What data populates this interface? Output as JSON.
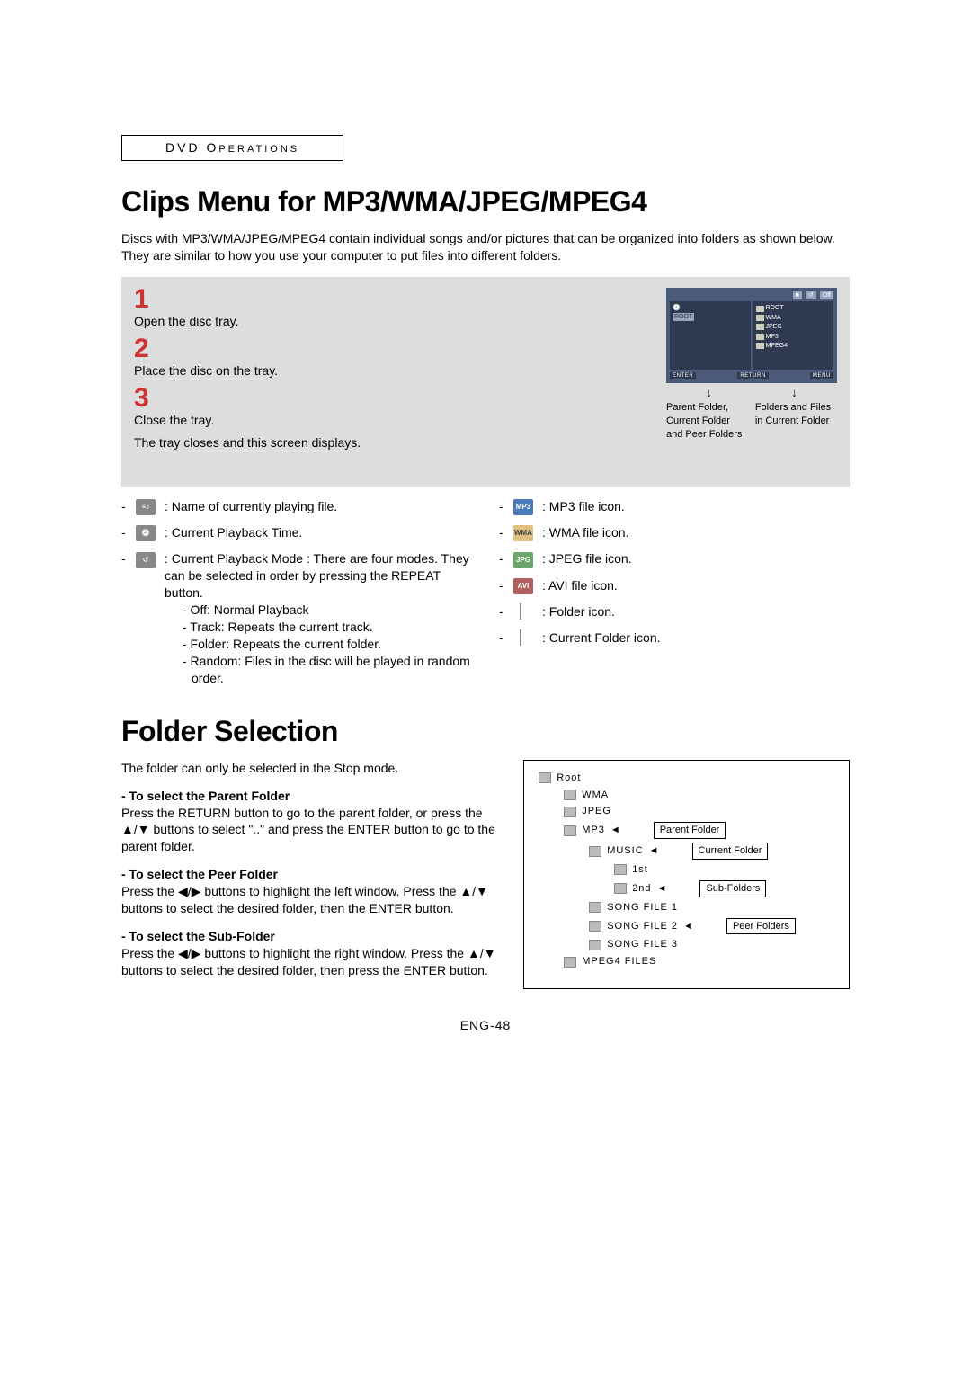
{
  "section": {
    "label_pre": "DVD O",
    "label_suf": "PERATIONS"
  },
  "h1_clips": "Clips Menu for MP3/WMA/JPEG/MPEG4",
  "intro": "Discs with MP3/WMA/JPEG/MPEG4 contain individual songs and/or pictures that can be organized into folders as shown below. They are similar to how you use your computer to put files into different folders.",
  "steps": {
    "n1": "1",
    "t1": "Open the disc tray.",
    "n2": "2",
    "t2": "Place the disc on the tray.",
    "n3": "3",
    "t3a": "Close the tray.",
    "t3b": "The tray closes and this screen displays."
  },
  "mock": {
    "off": "Off",
    "root_l": "ROOT",
    "root_r": "ROOT",
    "items": [
      "WMA",
      "JPEG",
      "MP3",
      "MPEG4"
    ],
    "bot1": "ENTER",
    "bot2": "RETURN",
    "bot3": "MENU",
    "cap_l": "Parent Folder, Current Folder and Peer Folders",
    "cap_r": "Folders and Files in Current Folder"
  },
  "iconsL": {
    "l1": "Name of currently playing file.",
    "l2": "Current Playback Time.",
    "l3": "Current Playback Mode : There are four modes. They can be selected in order by pressing the REPEAT button.",
    "b1": "- Off: Normal Playback",
    "b2": "- Track: Repeats the current track.",
    "b3": "- Folder: Repeats the current folder.",
    "b4": "- Random: Files in the disc will be played in random order."
  },
  "iconsR": {
    "mp3": ": MP3 file icon.",
    "wma": ": WMA file icon.",
    "jpg": ": JPEG file icon.",
    "avi": ": AVI file icon.",
    "fld": ": Folder icon.",
    "cur": ": Current Folder icon."
  },
  "h1_folder": "Folder Selection",
  "folder": {
    "lead": "The folder can only be selected in the Stop mode.",
    "p1h": "- To select the Parent Folder",
    "p1": "Press the RETURN button to go to the parent folder, or press the ▲/▼ buttons to select \"..\" and press the ENTER button to go to the parent folder.",
    "p2h": "- To select the Peer Folder",
    "p2": "Press the ◀/▶ buttons to highlight the left window. Press the ▲/▼ buttons to select the desired folder, then the ENTER button.",
    "p3h": "- To select the Sub-Folder",
    "p3": "Press the ◀/▶ buttons to highlight the right window. Press the ▲/▼ buttons to select the desired folder, then press the ENTER button."
  },
  "chart_data": {
    "type": "tree",
    "nodes": [
      {
        "level": 0,
        "label": "Root"
      },
      {
        "level": 1,
        "label": "WMA"
      },
      {
        "level": 1,
        "label": "JPEG"
      },
      {
        "level": 1,
        "label": "MP3",
        "callout": "Parent Folder"
      },
      {
        "level": 2,
        "label": "MUSIC",
        "callout": "Current Folder"
      },
      {
        "level": 3,
        "label": "1st"
      },
      {
        "level": 3,
        "label": "2nd",
        "callout": "Sub-Folders"
      },
      {
        "level": 2,
        "label": "SONG FILE 1"
      },
      {
        "level": 2,
        "label": "SONG FILE 2",
        "callout": "Peer Folders"
      },
      {
        "level": 2,
        "label": "SONG FILE 3"
      },
      {
        "level": 1,
        "label": "MPEG4 FILES"
      }
    ]
  },
  "tree": {
    "root": "Root",
    "wma": "WMA",
    "jpeg": "JPEG",
    "mp3": "MP3",
    "music": "MUSIC",
    "first": "1st",
    "second": "2nd",
    "sf1": "SONG FILE 1",
    "sf2": "SONG FILE 2",
    "sf3": "SONG FILE 3",
    "mpeg4": "MPEG4 FILES",
    "c_parent": "Parent Folder",
    "c_current": "Current Folder",
    "c_sub": "Sub-Folders",
    "c_peer": "Peer Folders"
  },
  "page": "ENG-48"
}
